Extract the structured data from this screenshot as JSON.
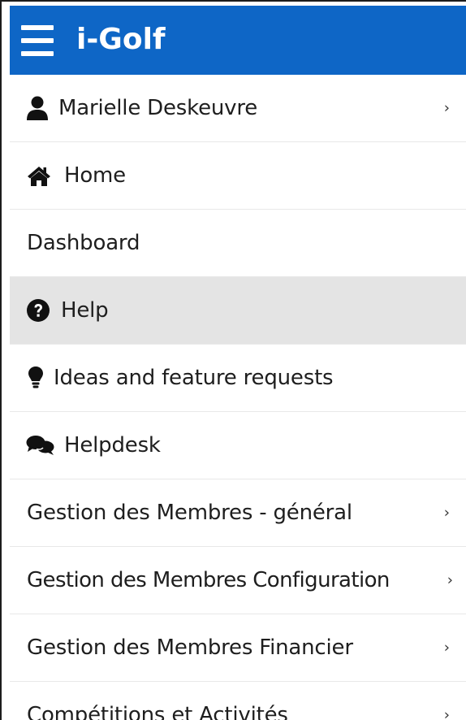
{
  "app": {
    "title": "i-Golf",
    "brand_color": "#0e66c6"
  },
  "menu": {
    "items": [
      {
        "label": "Marielle Deskeuvre",
        "icon": "user-icon",
        "has_submenu": true,
        "active": false
      },
      {
        "label": "Home",
        "icon": "home-icon",
        "has_submenu": false,
        "active": false
      },
      {
        "label": "Dashboard",
        "icon": "",
        "has_submenu": false,
        "active": false
      },
      {
        "label": "Help",
        "icon": "question-circle-icon",
        "has_submenu": false,
        "active": true
      },
      {
        "label": "Ideas and feature requests",
        "icon": "lightbulb-icon",
        "has_submenu": false,
        "active": false
      },
      {
        "label": "Helpdesk",
        "icon": "comments-icon",
        "has_submenu": false,
        "active": false
      },
      {
        "label": "Gestion des Membres - général",
        "icon": "",
        "has_submenu": true,
        "active": false
      },
      {
        "label": "Gestion des Membres Configuration",
        "icon": "",
        "has_submenu": true,
        "active": false
      },
      {
        "label": "Gestion des Membres Financier",
        "icon": "",
        "has_submenu": true,
        "active": false
      },
      {
        "label": "Compétitions et Activités",
        "icon": "",
        "has_submenu": true,
        "active": false
      }
    ],
    "chevron_glyph": "›",
    "active_background": "#e4e4e4"
  }
}
